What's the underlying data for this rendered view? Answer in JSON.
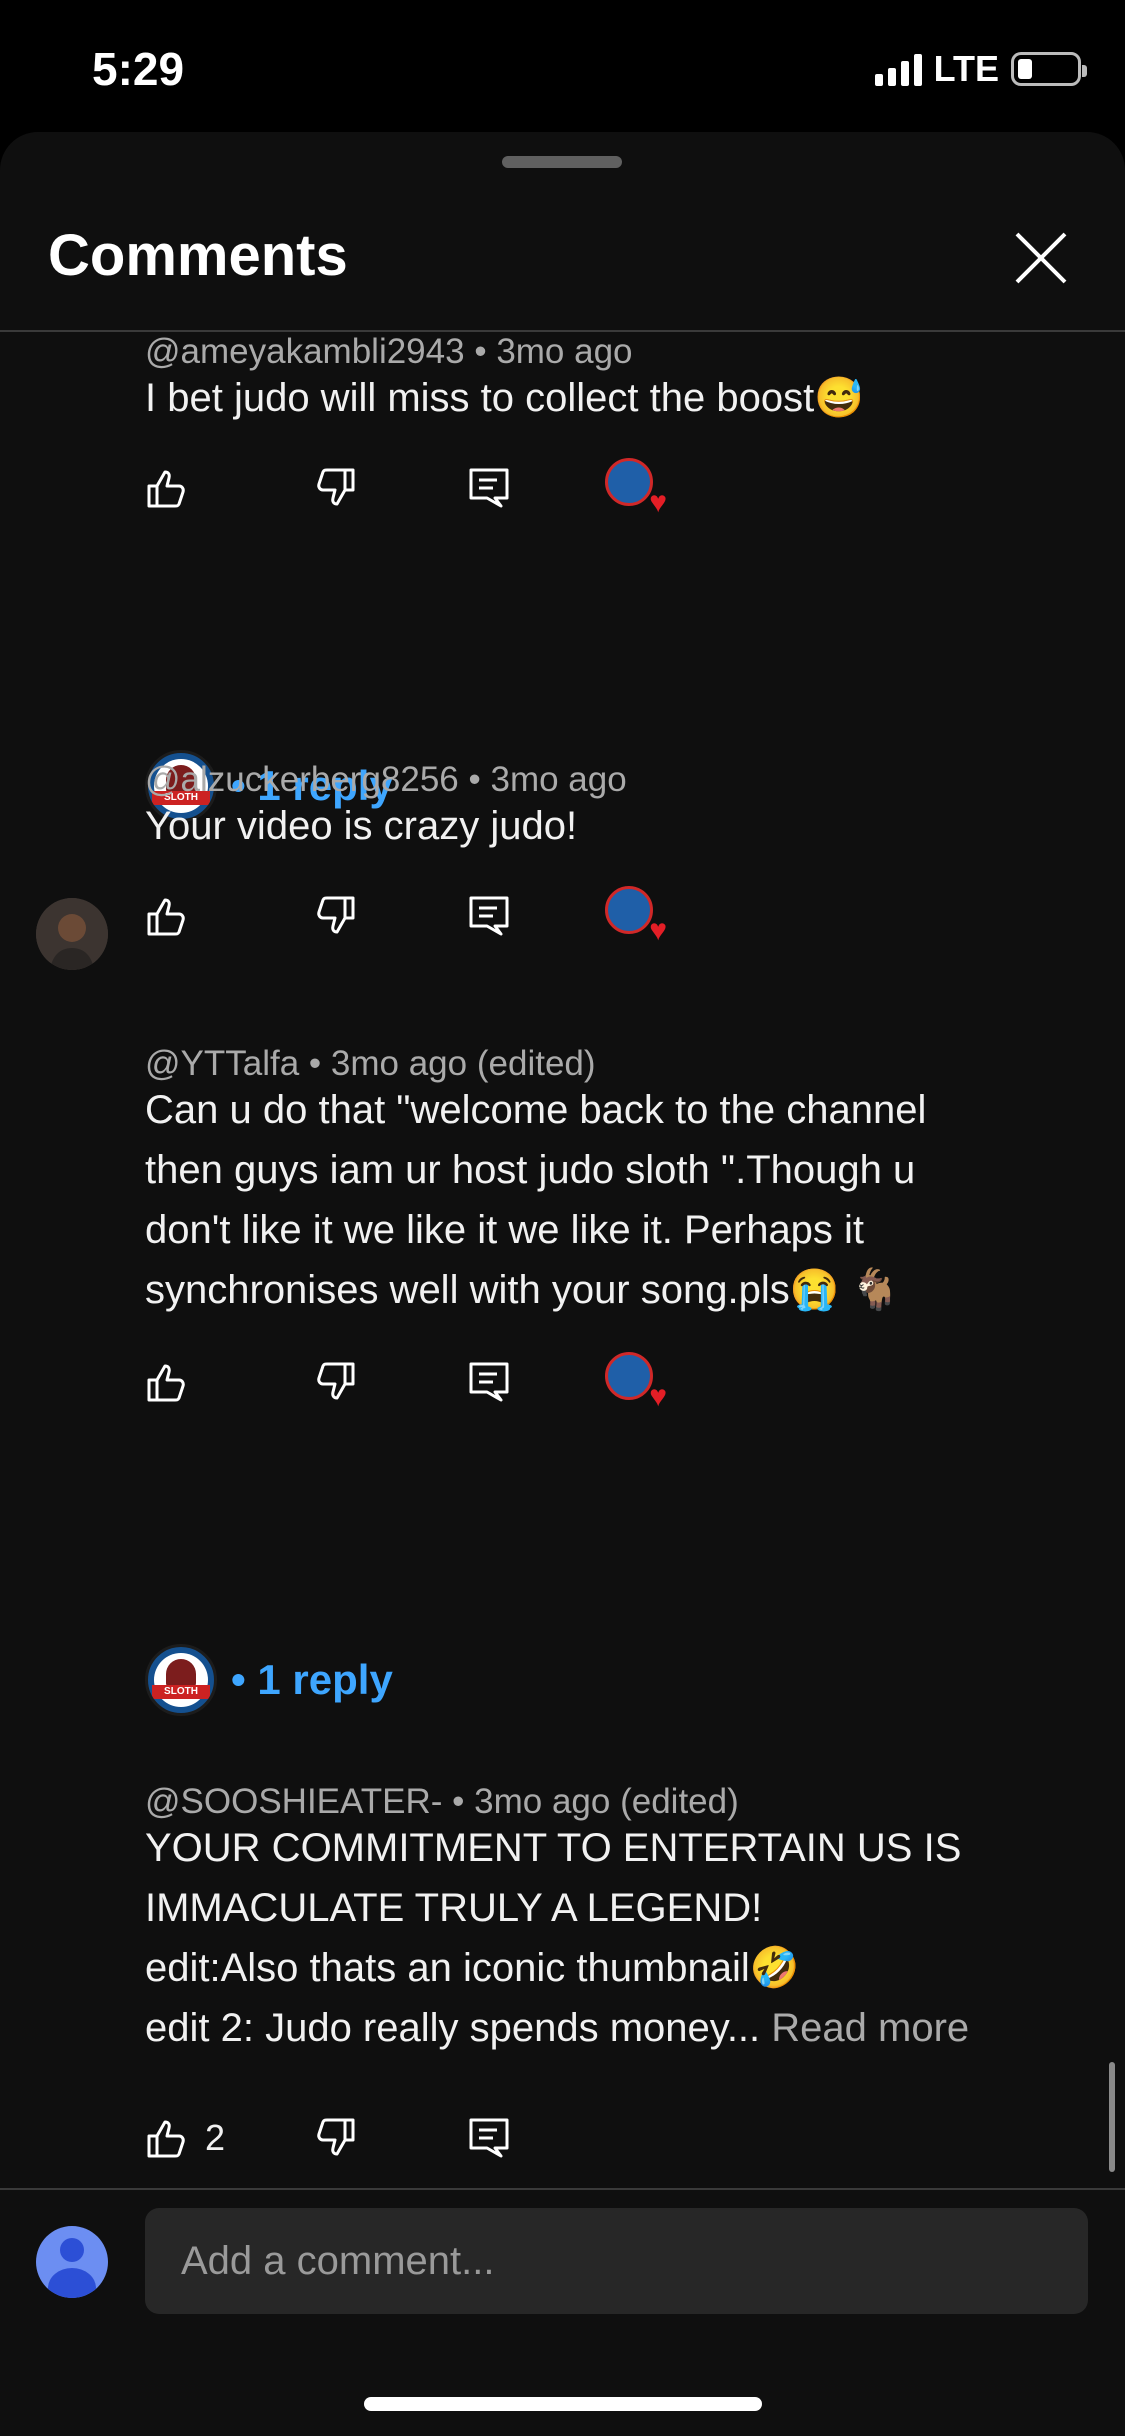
{
  "status_bar": {
    "time": "5:29",
    "network": "LTE"
  },
  "header": {
    "title": "Comments"
  },
  "comments": [
    {
      "author": "@ameyakambli2943",
      "age": "3mo ago",
      "edited": "",
      "text": "I bet judo will miss to collect the boost😅",
      "likes": "",
      "creator_heart": true,
      "replies": "1 reply"
    },
    {
      "author": "@alzuckerberg8256",
      "age": "3mo ago",
      "edited": "",
      "text": "Your video is crazy judo!",
      "likes": "",
      "creator_heart": true,
      "replies": ""
    },
    {
      "author": "@YTTalfa",
      "age": "3mo ago",
      "edited": "(edited)",
      "text_lines": [
        "Can u do that \"welcome back to the channel",
        "then guys iam ur host judo sloth \".Though u",
        "don't like it we like it we like it. Perhaps it",
        "synchronises well with your song.pls😭 🐐"
      ],
      "likes": "",
      "creator_heart": true,
      "replies": "1 reply"
    },
    {
      "author": "@SOOSHIEATER-",
      "age": "3mo ago",
      "edited": "(edited)",
      "text_lines": [
        "YOUR COMMITMENT TO ENTERTAIN US IS",
        "IMMACULATE TRULY A LEGEND!",
        "edit:Also thats an iconic thumbnail🤣",
        "edit 2: Judo really spends money..."
      ],
      "read_more": "Read more",
      "likes": "2",
      "creator_heart": false,
      "replies": ""
    }
  ],
  "reply_prefix": "•",
  "input": {
    "placeholder": "Add a comment..."
  },
  "colors": {
    "background": "#0f0f0f",
    "link": "#3ea6ff",
    "heart": "#e41e26"
  },
  "icons": [
    "like-icon",
    "dislike-icon",
    "reply-icon",
    "close-icon",
    "heart-icon"
  ]
}
